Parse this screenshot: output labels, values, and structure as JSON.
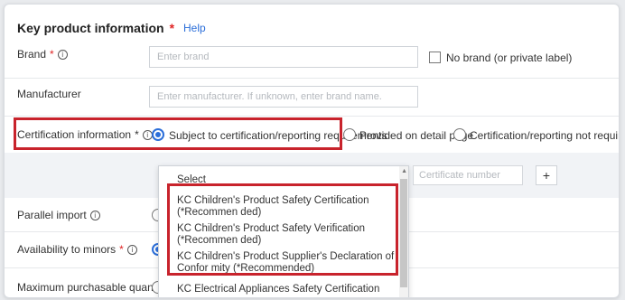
{
  "section": {
    "title": "Key product information",
    "required_mark": "*",
    "help": "Help"
  },
  "brand": {
    "label": "Brand",
    "req": "*",
    "info": "i",
    "placeholder": "Enter brand",
    "no_brand_label": "No brand (or private label)"
  },
  "manufacturer": {
    "label": "Manufacturer",
    "placeholder": "Enter manufacturer. If unknown, enter brand name."
  },
  "certification": {
    "label": "Certification information",
    "req": "*",
    "info": "i",
    "options": [
      {
        "label": "Subject to certification/reporting requirements",
        "selected": true
      },
      {
        "label": "Provided on detail page",
        "selected": false
      },
      {
        "label": "Certification/reporting not required",
        "selected": false
      }
    ],
    "certificate_placeholder": "Certificate number",
    "add_label": "+"
  },
  "dropdown": {
    "selected": "Select",
    "items": [
      "KC Children's Product Safety Certification (*Recommen ded)",
      "KC Children's Product Safety Verification (*Recommen ded)",
      "KC Children's Product Supplier's Declaration of Confor mity (*Recommended)",
      "KC Electrical Appliances Safety Certification"
    ]
  },
  "parallel_import": {
    "label": "Parallel import",
    "info": "i"
  },
  "minors": {
    "label": "Availability to minors",
    "req": "*",
    "info": "i"
  },
  "max_purchase": {
    "label": "Maximum purchasable quanti"
  },
  "colors": {
    "accent": "#2b6ed9",
    "highlight": "#c8232c",
    "required": "#e02424"
  }
}
